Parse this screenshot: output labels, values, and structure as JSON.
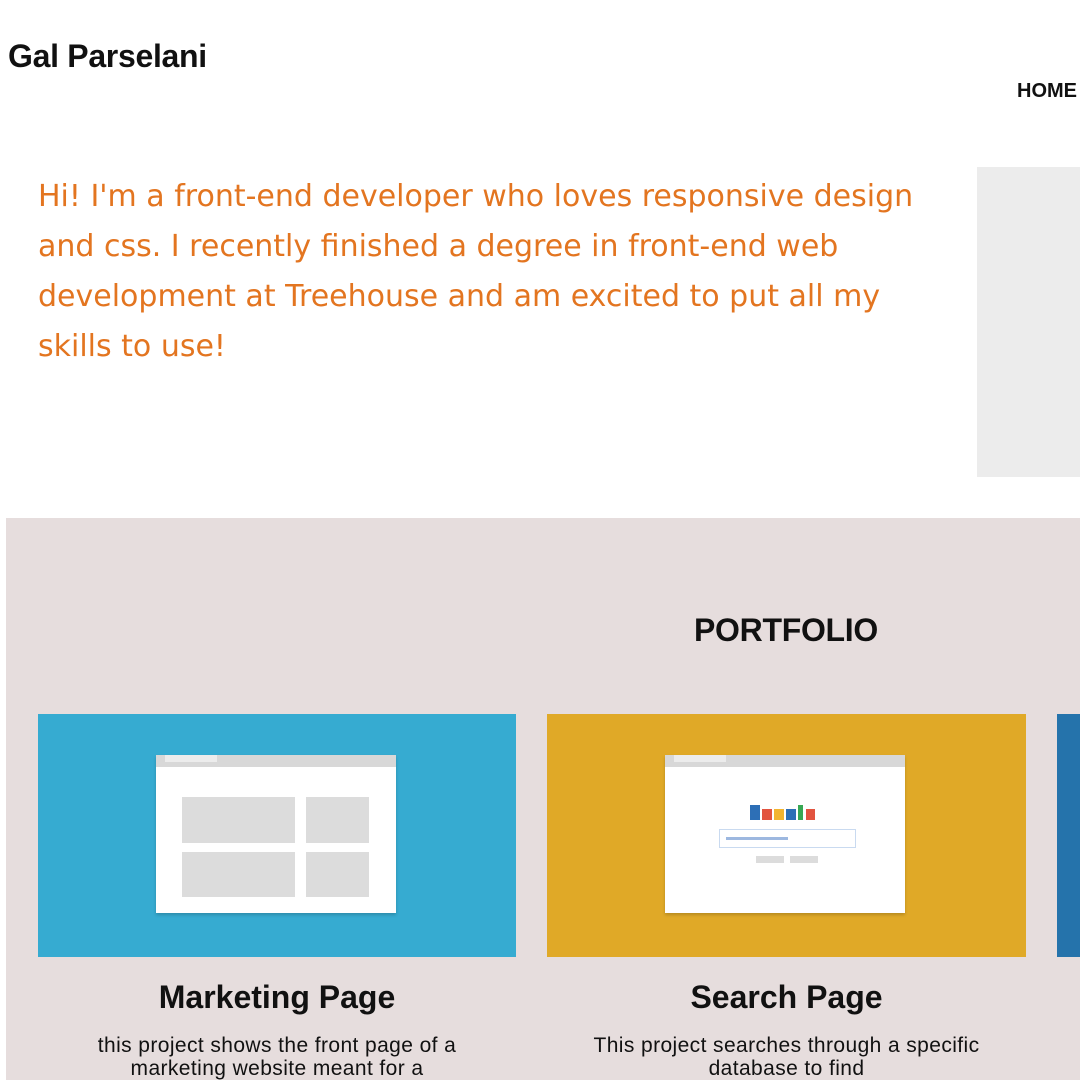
{
  "header": {
    "site_name": "Gal Parselani",
    "nav": {
      "home_label": "HOME"
    }
  },
  "intro": {
    "text": "Hi! I'm a front-end developer who loves responsive design and css. I recently finished a degree in front-end web development at Treehouse and am excited to put all my skills to use!"
  },
  "portfolio": {
    "heading": "PORTFOLIO",
    "cards": [
      {
        "title": "Marketing Page",
        "description": "this project shows the front page of a marketing website meant for a",
        "thumb_color": "#36abd1",
        "thumb_icon": "layout-wireframe-icon"
      },
      {
        "title": "Search Page",
        "description": "This project searches through a specific database to find",
        "thumb_color": "#e0a927",
        "thumb_icon": "search-wireframe-icon"
      },
      {
        "title": "",
        "description": "",
        "thumb_color": "#2573ab"
      }
    ]
  },
  "colors": {
    "intro_text": "#e37520",
    "portfolio_bg": "#e6dddd",
    "photo_placeholder": "#ececec",
    "logo_bars": [
      "#2d6fb6",
      "#e2543f",
      "#f2b430",
      "#2d6fb6",
      "#37a853",
      "#e2543f"
    ]
  }
}
